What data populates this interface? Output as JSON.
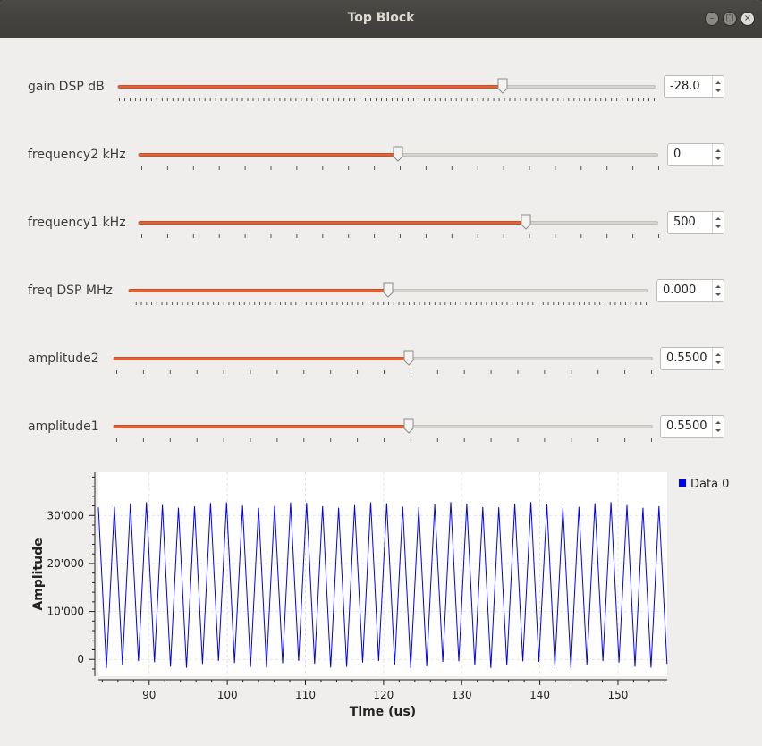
{
  "window": {
    "title": "Top Block"
  },
  "controls": [
    {
      "label": "gain DSP dB",
      "value": "-28.0",
      "fraction": 0.74,
      "fine_ticks": true
    },
    {
      "label": "frequency2 kHz",
      "value": "0",
      "fraction": 0.5,
      "fine_ticks": false
    },
    {
      "label": "frequency1 kHz",
      "value": "500",
      "fraction": 0.745,
      "fine_ticks": false
    },
    {
      "label": "freq DSP MHz",
      "value": "0.000",
      "fraction": 0.5,
      "fine_ticks": true
    },
    {
      "label": "amplitude2",
      "value": "0.5500",
      "fraction": 0.55,
      "fine_ticks": false
    },
    {
      "label": "amplitude1",
      "value": "0.5500",
      "fraction": 0.55,
      "fine_ticks": false
    }
  ],
  "chart_data": {
    "type": "line",
    "xlabel": "Time (us)",
    "ylabel": "Amplitude",
    "xlim": [
      83.5,
      156.3
    ],
    "ylim": [
      -3500,
      39000
    ],
    "xticks": [
      "90",
      "100",
      "110",
      "120",
      "130",
      "140",
      "150"
    ],
    "xtick_values": [
      90,
      100,
      110,
      120,
      130,
      140,
      150
    ],
    "yticks": [
      "0",
      "10'000",
      "20'000",
      "30'000"
    ],
    "ytick_values": [
      0,
      10000,
      20000,
      30000
    ],
    "legend": "top-right",
    "series": [
      {
        "name": "Data 0",
        "color": "#0000ee",
        "period_us": 2.05,
        "x_start": 83.5,
        "x_end": 156.3,
        "high": 32800,
        "low": -1800
      }
    ]
  }
}
